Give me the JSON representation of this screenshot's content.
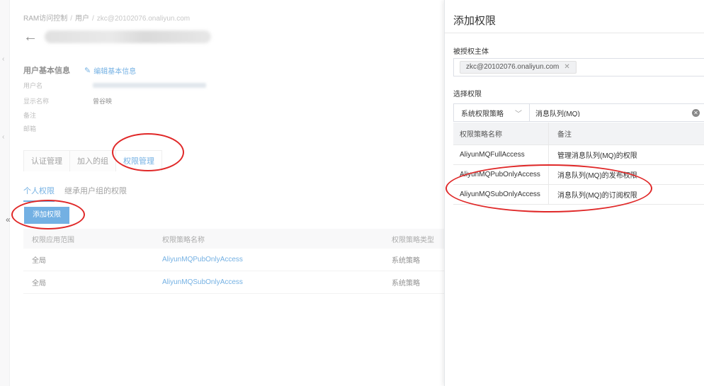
{
  "breadcrumb": {
    "root": "RAM访问控制",
    "users": "用户",
    "current": "zkc@20102076.onaliyun.com"
  },
  "user_info": {
    "title": "用户基本信息",
    "edit_label": "编辑基本信息",
    "fields": [
      {
        "label": "用户名",
        "value": ""
      },
      {
        "label": "显示名称",
        "value": "曾谷映"
      },
      {
        "label": "备注",
        "value": ""
      },
      {
        "label": "邮箱",
        "value": ""
      }
    ]
  },
  "tabs": [
    {
      "label": "认证管理",
      "active": false
    },
    {
      "label": "加入的组",
      "active": false
    },
    {
      "label": "权限管理",
      "active": true
    }
  ],
  "subtabs": [
    {
      "label": "个人权限",
      "active": true
    },
    {
      "label": "继承用户组的权限",
      "active": false
    }
  ],
  "add_button": "添加权限",
  "permission_list": {
    "headers": [
      "权限应用范围",
      "权限策略名称",
      "权限策略类型"
    ],
    "rows": [
      {
        "scope": "全局",
        "policy": "AliyunMQPubOnlyAccess",
        "type": "系统策略"
      },
      {
        "scope": "全局",
        "policy": "AliyunMQSubOnlyAccess",
        "type": "系统策略"
      }
    ]
  },
  "drawer": {
    "title": "添加权限",
    "principal_label": "被授权主体",
    "principal_tag": "zkc@20102076.onaliyun.com",
    "select_label": "选择权限",
    "policy_type": "系统权限策略",
    "search_value": "消息队列(MQ)",
    "table_headers": [
      "权限策略名称",
      "备注"
    ],
    "policies": [
      {
        "name": "AliyunMQFullAccess",
        "note": "管理消息队列(MQ)的权限"
      },
      {
        "name": "AliyunMQPubOnlyAccess",
        "note": "消息队列(MQ)的发布权限"
      },
      {
        "name": "AliyunMQSubOnlyAccess",
        "note": "消息队列(MQ)的订阅权限"
      }
    ]
  },
  "colors": {
    "accent": "#0070cc",
    "annotation": "#e02828"
  }
}
